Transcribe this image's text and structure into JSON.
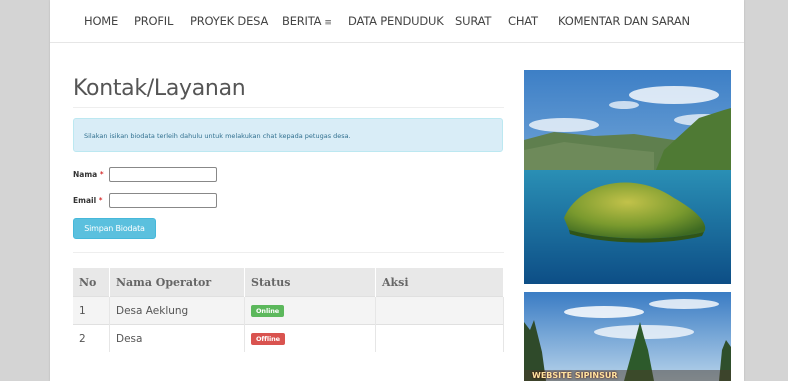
{
  "nav": {
    "items": [
      {
        "label": "HOME"
      },
      {
        "label": "PROFIL"
      },
      {
        "label": "PROYEK DESA"
      },
      {
        "label": "BERITA",
        "caret": "≡"
      },
      {
        "label": "DATA PENDUDUK"
      },
      {
        "label": "SURAT"
      },
      {
        "label": "CHAT"
      },
      {
        "label": "KOMENTAR DAN SARAN"
      }
    ]
  },
  "page": {
    "title": "Kontak/Layanan",
    "alert": "Silakan isikan biodata terleih dahulu untuk melakukan chat kepada petugas desa."
  },
  "form": {
    "name_label": "Nama",
    "email_label": "Email",
    "required_mark": "*",
    "name_value": "",
    "email_value": "",
    "submit_label": "Simpan Biodata"
  },
  "table": {
    "headers": [
      "No",
      "Nama Operator",
      "Status",
      "Aksi"
    ],
    "rows": [
      {
        "no": "1",
        "name": "Desa Aeklung",
        "status": "Online",
        "aksi": ""
      },
      {
        "no": "2",
        "name": "Desa",
        "status": "Offline",
        "aksi": ""
      }
    ]
  },
  "sidebar": {
    "photo1_alt": "lake-island-photo",
    "photo2_caption": "WEBSITE SIPINSUR"
  },
  "colors": {
    "alert_bg": "#d9edf7",
    "button_bg": "#5bc0de",
    "online": "#5cb85c",
    "offline": "#d9534f"
  }
}
